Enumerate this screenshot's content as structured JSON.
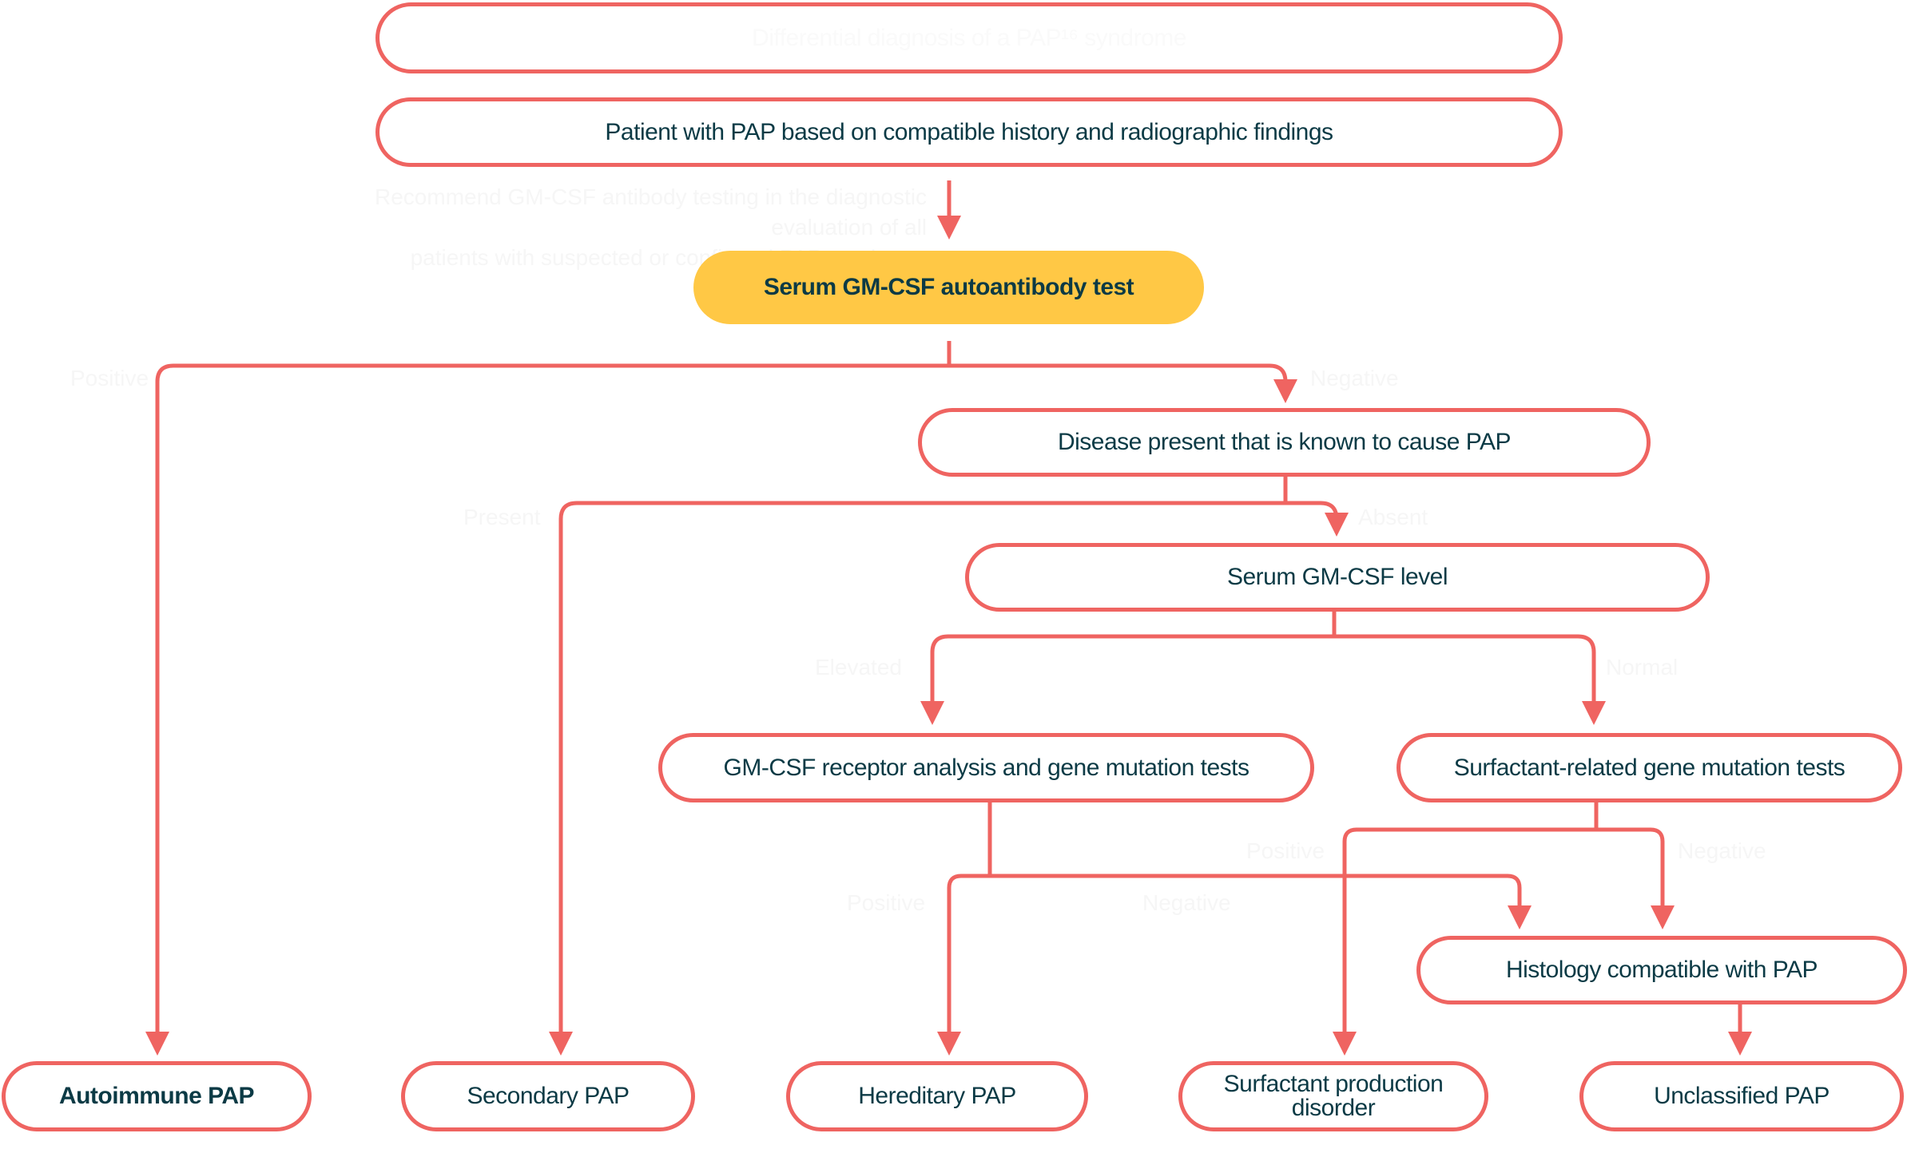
{
  "title": "Differential diagnosis of a PAP¹⁶ syndrome",
  "recommendation": {
    "line1": "Recommend GM-CSF antibody testing in the diagnostic evaluation of all",
    "line2": "patients with suspected or confirmed PAP syndrome"
  },
  "colors": {
    "connector": "#EF6461",
    "highlight": "#FFC845",
    "text": "#0B3A45"
  },
  "nodes": {
    "start": "Patient with PAP based on compatible history and radiographic findings",
    "antibody_test": "Serum GM-CSF autoantibody test",
    "disease_present": "Disease present that is known to cause PAP",
    "serum_level": "Serum GM-CSF level",
    "receptor_analysis": "GM-CSF receptor analysis and gene mutation tests",
    "surfactant_tests": "Surfactant-related gene mutation tests",
    "histology": "Histology compatible with PAP",
    "autoimmune": "Autoimmune PAP",
    "secondary": "Secondary PAP",
    "hereditary": "Hereditary PAP",
    "surfactant_disorder_line1": "Surfactant production",
    "surfactant_disorder_line2": "disorder",
    "unclassified": "Unclassified PAP"
  },
  "edge_labels": {
    "antibody_positive": "Positive",
    "antibody_negative": "Negative",
    "disease_present": "Present",
    "disease_absent": "Absent",
    "level_elevated": "Elevated",
    "level_normal": "Normal",
    "receptor_positive": "Positive",
    "receptor_negative": "Negative",
    "surfactant_positive": "Positive",
    "surfactant_negative": "Negative"
  }
}
